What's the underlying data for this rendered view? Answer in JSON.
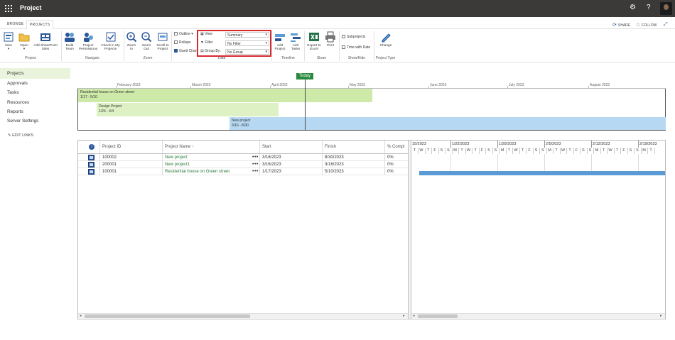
{
  "app": {
    "title": "Project"
  },
  "topbar": {
    "settings_icon": "gear-icon",
    "help_label": "?"
  },
  "tabs": {
    "browse": "BROWSE",
    "projects": "PROJECTS"
  },
  "tab_actions": {
    "share": "SHARE",
    "follow": "FOLLOW"
  },
  "ribbon": {
    "new": "New",
    "open": "Open",
    "add_sharepoint_1": "Add",
    "add_sharepoint_2": "SharePoint",
    "add_sharepoint_3": "Sites",
    "group_project": "Project",
    "build_team_1": "Build",
    "build_team_2": "Team",
    "permissions_1": "Project",
    "permissions_2": "Permissions",
    "checkin_1": "Check in My",
    "checkin_2": "Projects",
    "group_navigate": "Navigate",
    "zoom_in_1": "Zoom",
    "zoom_in_2": "In",
    "zoom_out_1": "Zoom",
    "zoom_out_2": "Out",
    "scroll_1": "Scroll to",
    "scroll_2": "Project",
    "group_zoom": "Zoom",
    "outline": "Outline",
    "rollups": "Rollups",
    "gantt_chart": "Gantt Chart",
    "view_label": "View",
    "filter_label": "Filter",
    "groupby_label": "Group By:",
    "view_value": "Summary",
    "filter_value": "No Filter",
    "groupby_value": "No Group",
    "group_data": "Data",
    "add_project_1": "Add",
    "add_project_2": "Project",
    "add_tasks_1": "Add",
    "add_tasks_2": "Tasks",
    "group_timeline": "Timeline",
    "export_1": "Export to",
    "export_2": "Excel",
    "print": "Print",
    "group_share": "Share",
    "subprojects": "Subprojects",
    "time_with_date": "Time with Date",
    "group_showhide": "Show/Hide",
    "change": "Change",
    "group_project_type": "Project Type"
  },
  "nav": {
    "items": [
      "Projects",
      "Approvals",
      "Tasks",
      "Resources",
      "Reports",
      "Server Settings"
    ],
    "edit_links": "EDIT LINKS"
  },
  "timeline": {
    "today": "Today",
    "months": [
      "February 2023",
      "March 2023",
      "April 2023",
      "May 2023",
      "June 2023",
      "July 2023",
      "August 2023"
    ],
    "bars": [
      {
        "name": "Residential house on Green street",
        "dates": "1/17 - 5/10"
      },
      {
        "name": "Design Project",
        "dates": "1/24 - 4/4"
      },
      {
        "name": "New project",
        "dates": "3/16 - 8/30"
      }
    ],
    "colors": {
      "green": "#cdeaa9",
      "light_green": "#ddf1c4",
      "blue": "#b6d8f2"
    }
  },
  "grid": {
    "columns": {
      "id": "Project ID",
      "name": "Project Name ↑",
      "start": "Start",
      "finish": "Finish",
      "pct": "% Compl"
    },
    "rows": [
      {
        "id": "100002",
        "name": "New project",
        "start": "3/16/2023",
        "finish": "8/30/2023",
        "pct": "0%"
      },
      {
        "id": "200001",
        "name": "New project1",
        "start": "3/16/2023",
        "finish": "3/16/2023",
        "pct": "0%"
      },
      {
        "id": "100001",
        "name": "Residential house on Green street",
        "start": "1/17/2023",
        "finish": "5/10/2023",
        "pct": "0%"
      }
    ],
    "more_label": "•••"
  },
  "gantt": {
    "weeks": [
      "15/2023",
      "1/22/2023",
      "1/29/2023",
      "2/5/2023",
      "2/12/2023",
      "2/19/2023"
    ],
    "days": [
      "M",
      "T",
      "W",
      "T",
      "F",
      "S",
      "S"
    ]
  }
}
